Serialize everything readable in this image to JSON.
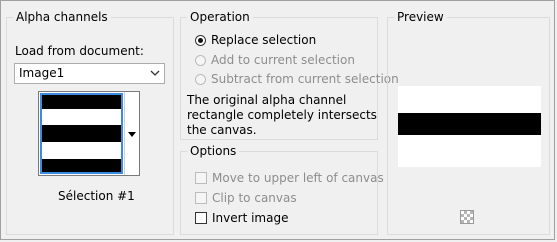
{
  "alpha_channels": {
    "title": "Alpha channels",
    "load_from_label": "Load from document:",
    "document_select": {
      "value": "Image1"
    },
    "selection_caption": "Sélection #1"
  },
  "operation": {
    "title": "Operation",
    "options": [
      {
        "label": "Replace selection",
        "checked": true,
        "enabled": true
      },
      {
        "label": "Add to current selection",
        "checked": false,
        "enabled": false
      },
      {
        "label": "Subtract from current selection",
        "checked": false,
        "enabled": false
      }
    ],
    "description": "The original alpha channel rectangle completely intersects the canvas."
  },
  "options_group": {
    "title": "Options",
    "items": [
      {
        "label": "Move to upper left of canvas",
        "checked": false,
        "enabled": false
      },
      {
        "label": "Clip to canvas",
        "checked": false,
        "enabled": false
      },
      {
        "label": "Invert image",
        "checked": false,
        "enabled": true
      }
    ]
  },
  "preview": {
    "title": "Preview"
  },
  "colors": {
    "selection_border": "#3b8be0",
    "background": "#f0f0f0"
  },
  "icons": {
    "combo": "chevron-down-icon",
    "thumb_dropdown": "triangle-down-icon",
    "checker": "transparency-checker-icon"
  }
}
